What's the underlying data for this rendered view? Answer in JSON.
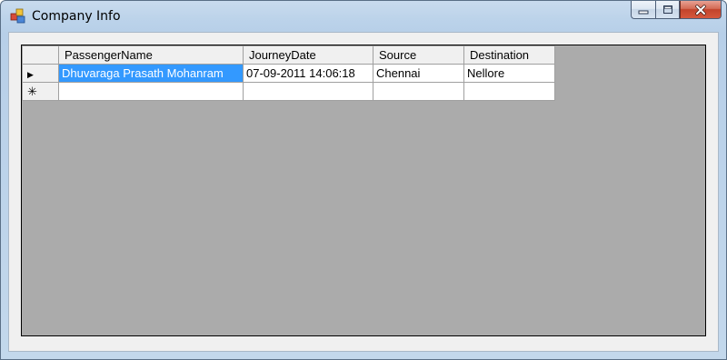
{
  "window": {
    "title": "Company Info",
    "icon": "form-app-icon",
    "controls": [
      "minimize-icon",
      "maximize-icon",
      "close-icon"
    ]
  },
  "grid": {
    "columns": [
      "PassengerName",
      "JourneyDate",
      "Source",
      "Destination"
    ],
    "rows": [
      {
        "indicator": "▶",
        "cells": [
          "Dhuvaraga Prasath Mohanram",
          "07-09-2011 14:06:18",
          "Chennai",
          "Nellore"
        ],
        "selected_cell": 0
      }
    ],
    "new_row_indicator": "✳",
    "selection_color": "#3399ff",
    "background_color": "#ababab"
  }
}
